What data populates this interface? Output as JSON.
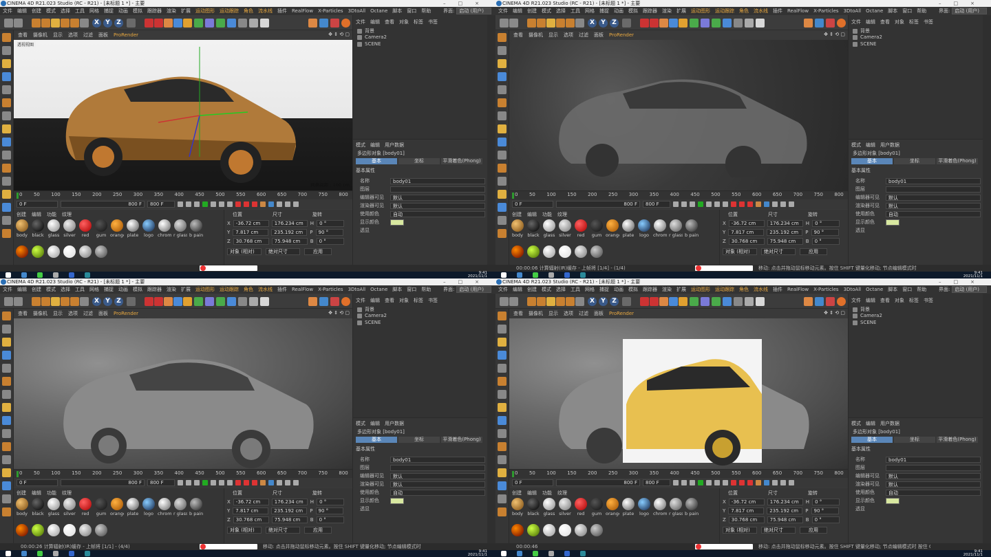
{
  "quadrants": [
    {
      "title": "CINEMA 4D R21.023 Studio (RC - R21) - [未标题 1 *] - 主要",
      "menu": [
        "文件",
        "编辑",
        "创建",
        "模式",
        "选择",
        "工具",
        "网格",
        "捕捉",
        "动画",
        "模拟",
        "跟踪器",
        "渲染",
        "扩展",
        "运动图形",
        "运动跟踪",
        "角色",
        "流水线",
        "插件",
        "RealFlow",
        "X-Particles",
        "3DtoAll",
        "Octane",
        "脚本",
        "窗口",
        "帮助"
      ],
      "layout_label": "界面:",
      "layout_value": "启动 (用户)",
      "viewport_menu": [
        "查看",
        "摄像机",
        "显示",
        "选项",
        "过滤",
        "面板"
      ],
      "prorender": "ProRender",
      "viewport_label": "透视视图",
      "grid_text": "网格间距 : 100 cm",
      "timeline_ticks": [
        "0",
        "50",
        "100",
        "150",
        "200",
        "250",
        "300",
        "350",
        "400",
        "450",
        "500",
        "550",
        "600",
        "650",
        "700",
        "750",
        "800"
      ],
      "timeline_end": "0 F",
      "frame_start": "0 F",
      "frame_mid": "800 F",
      "frame_end": "800 F",
      "mat_tabs": [
        "创建",
        "编辑",
        "功能",
        "纹理"
      ],
      "materials_row1": [
        "body",
        "black",
        "glass",
        "silver",
        "red",
        "gum",
        "orange",
        "plate",
        "logo",
        "chrome",
        "r glass",
        "b paint"
      ],
      "coord_headers": [
        "位置",
        "尺寸",
        "旋转"
      ],
      "coords": [
        {
          "axis": "X",
          "pos": "-36.72 cm",
          "size": "176.234 cm",
          "rot_axis": "H",
          "rot": "0 °"
        },
        {
          "axis": "Y",
          "pos": "7.817 cm",
          "size": "235.192 cm",
          "rot_axis": "P",
          "rot": "90 °"
        },
        {
          "axis": "Z",
          "pos": "30.768 cm",
          "size": "75.948 cm",
          "rot_axis": "B",
          "rot": "0 °"
        }
      ],
      "coord_mode1": "对象 (相对)",
      "coord_mode2": "绝对尺寸",
      "apply": "应用",
      "obj_tabs": [
        "文件",
        "编辑",
        "查看",
        "对象",
        "标签",
        "书签"
      ],
      "objects": [
        "背景",
        "Camera2",
        "SCENE"
      ],
      "attr_tabs": [
        "模式",
        "编辑",
        "用户数据"
      ],
      "attr_title": "多边形对象 [body01]",
      "attr_subtabs": [
        "基本",
        "坐标",
        "平滑着色(Phong)"
      ],
      "attr_section": "基本属性",
      "attr_rows": [
        {
          "k": "名称",
          "v": "body01"
        },
        {
          "k": "图层",
          "v": ""
        },
        {
          "k": "编辑器可见",
          "v": "默认"
        },
        {
          "k": "渲染器可见",
          "v": "默认"
        },
        {
          "k": "使用颜色",
          "v": "自动"
        },
        {
          "k": "显示颜色",
          "v": ""
        },
        {
          "k": "透显",
          "v": ""
        }
      ],
      "status": "",
      "clock_time": "9:41",
      "clock_date": "2021/11/1"
    },
    {
      "status": "00:00:06 计算辐射(IR)缓存 - 上帧将 [1/4] - (1/4)",
      "status_right": "移动: 点击并拖动鼠标移动元素。按住 SHIFT 键量化移动; 节点编辑模式时"
    },
    {
      "status": "00:00:26 计算辐射(IR)缓存 - 上帧将 [1/1] - (4/4)",
      "status_right": "移动: 点击并拖动鼠标移动元素。按住 SHIFT 键量化移动; 节点编辑模式时"
    },
    {
      "status": "00:00:46",
      "status_right": "移动: 点击并拖动鼠标移动元素。按住 SHIFT 键量化移动; 节点编辑模式时 按住 CTRL"
    }
  ]
}
